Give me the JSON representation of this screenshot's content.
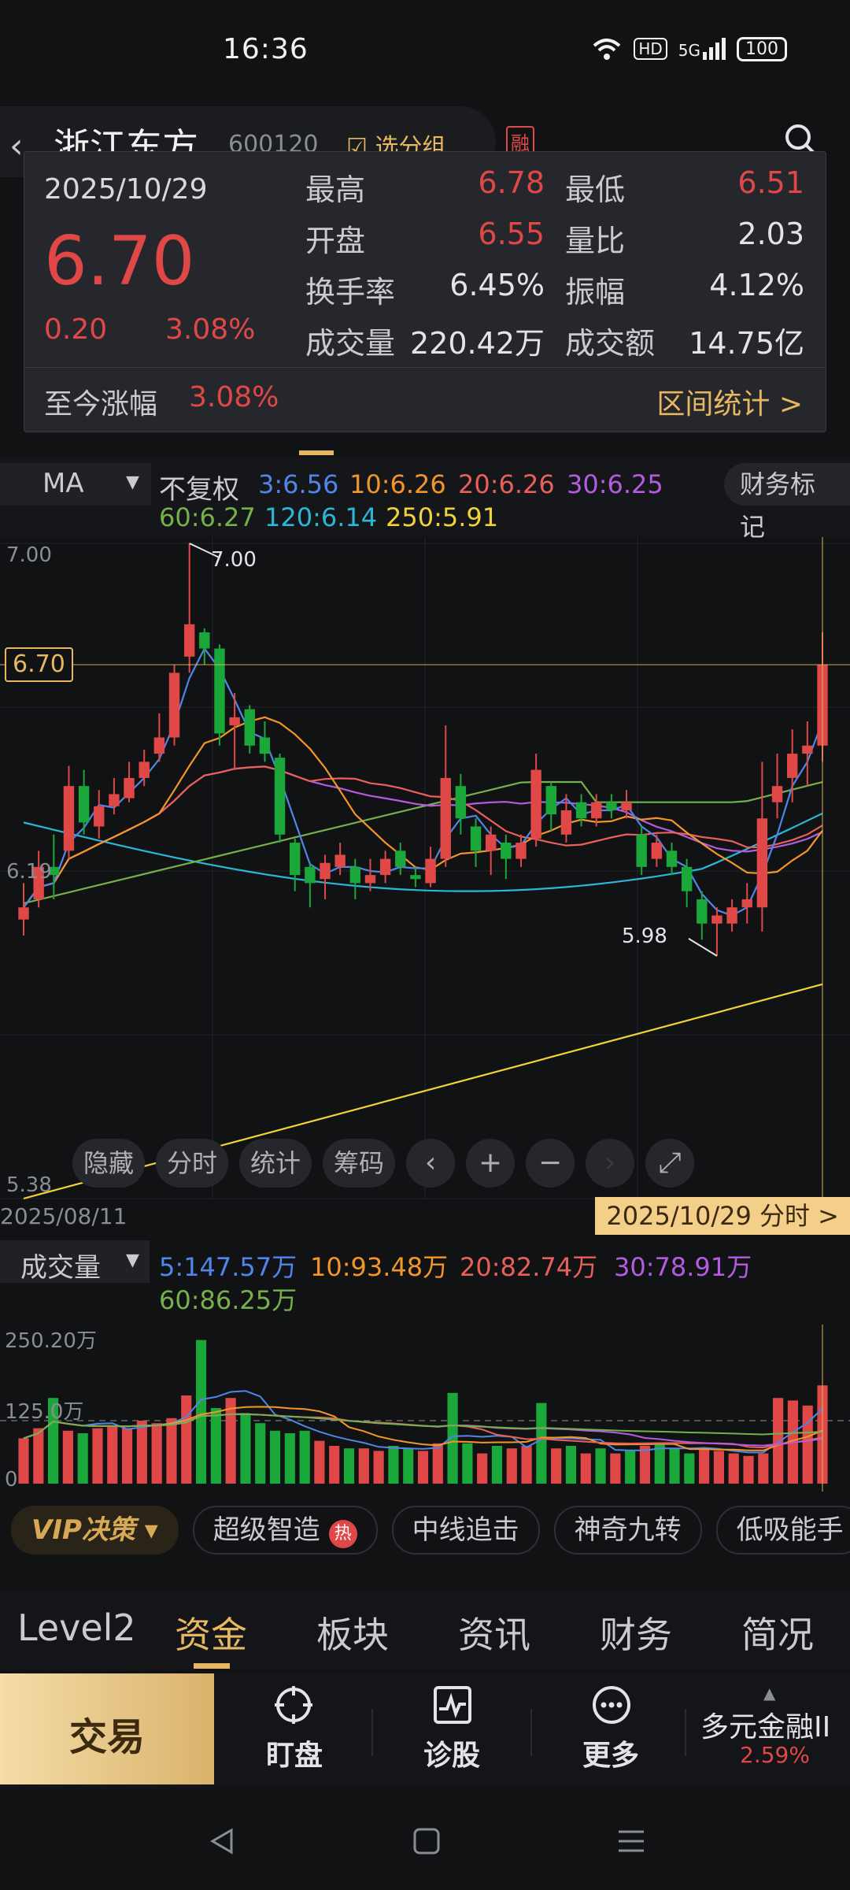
{
  "status_bar": {
    "time": "16:36",
    "hd": "HD",
    "signal": "5G",
    "battery": "100"
  },
  "header": {
    "stock_name": "浙江东方",
    "stock_code": "600120",
    "add_group": "选分组",
    "badge": "融"
  },
  "info_card": {
    "date": "2025/10/29",
    "price": "6.70",
    "change": "0.20",
    "change_pct": "3.08%",
    "rows": [
      {
        "l1": "最高",
        "v1": "6.78",
        "l2": "最低",
        "v2": "6.51"
      },
      {
        "l1": "开盘",
        "v1": "6.55",
        "l2": "量比",
        "v2": "2.03"
      },
      {
        "l1": "换手率",
        "v1": "6.45%",
        "l2": "振幅",
        "v2": "4.12%"
      },
      {
        "l1": "成交量",
        "v1": "220.42万",
        "l2": "成交额",
        "v2": "14.75亿"
      }
    ],
    "cum_label": "至今涨幅",
    "cum_value": "3.08%",
    "range_stats": "区间统计 >"
  },
  "ma_bar": {
    "selector": "MA",
    "adjust": "不复权",
    "ma3": "3:6.56",
    "ma10": "10:6.26",
    "ma20": "20:6.26",
    "ma30": "30:6.25",
    "ma60": "60:6.27",
    "ma120": "120:6.14",
    "ma250": "250:5.91",
    "fin_mark": "财务标记"
  },
  "colors": {
    "up": "#e04848",
    "down": "#1aa83a",
    "ma3": "#4f86e8",
    "ma10": "#f2962c",
    "ma20": "#e8605a",
    "ma30": "#b35ce0",
    "ma60": "#76b04a",
    "ma120": "#2bb7d6",
    "ma250": "#f2d23a",
    "accent": "#e7b861"
  },
  "chart_data": {
    "type": "candlestick",
    "y_axis_top": "7.00",
    "y_axis_mid": "6.19",
    "y_axis_bottom": "5.38",
    "ylim": [
      5.38,
      7.0
    ],
    "current_price_label": "6.70",
    "high_annotation": "7.00",
    "low_annotation": "5.98",
    "x_start": "2025/08/11",
    "x_end": "2025/10/29 分时 >",
    "candles": [
      {
        "o": 6.07,
        "c": 6.1,
        "h": 6.16,
        "l": 6.03
      },
      {
        "o": 6.12,
        "c": 6.2,
        "h": 6.24,
        "l": 6.1
      },
      {
        "o": 6.2,
        "c": 6.18,
        "h": 6.28,
        "l": 6.12
      },
      {
        "o": 6.24,
        "c": 6.4,
        "h": 6.45,
        "l": 6.22
      },
      {
        "o": 6.4,
        "c": 6.31,
        "h": 6.44,
        "l": 6.28
      },
      {
        "o": 6.3,
        "c": 6.35,
        "h": 6.39,
        "l": 6.27
      },
      {
        "o": 6.35,
        "c": 6.38,
        "h": 6.42,
        "l": 6.33
      },
      {
        "o": 6.37,
        "c": 6.42,
        "h": 6.46,
        "l": 6.36
      },
      {
        "o": 6.42,
        "c": 6.46,
        "h": 6.49,
        "l": 6.4
      },
      {
        "o": 6.48,
        "c": 6.52,
        "h": 6.58,
        "l": 6.46
      },
      {
        "o": 6.52,
        "c": 6.68,
        "h": 6.7,
        "l": 6.5
      },
      {
        "o": 6.72,
        "c": 6.8,
        "h": 7.0,
        "l": 6.68
      },
      {
        "o": 6.78,
        "c": 6.74,
        "h": 6.79,
        "l": 6.7
      },
      {
        "o": 6.74,
        "c": 6.53,
        "h": 6.75,
        "l": 6.5
      },
      {
        "o": 6.55,
        "c": 6.57,
        "h": 6.63,
        "l": 6.44
      },
      {
        "o": 6.59,
        "c": 6.5,
        "h": 6.6,
        "l": 6.48
      },
      {
        "o": 6.52,
        "c": 6.48,
        "h": 6.56,
        "l": 6.46
      },
      {
        "o": 6.47,
        "c": 6.28,
        "h": 6.48,
        "l": 6.26
      },
      {
        "o": 6.26,
        "c": 6.18,
        "h": 6.27,
        "l": 6.14
      },
      {
        "o": 6.2,
        "c": 6.16,
        "h": 6.21,
        "l": 6.1
      },
      {
        "o": 6.17,
        "c": 6.21,
        "h": 6.23,
        "l": 6.12
      },
      {
        "o": 6.2,
        "c": 6.23,
        "h": 6.26,
        "l": 6.18
      },
      {
        "o": 6.2,
        "c": 6.16,
        "h": 6.22,
        "l": 6.12
      },
      {
        "o": 6.16,
        "c": 6.18,
        "h": 6.22,
        "l": 6.14
      },
      {
        "o": 6.18,
        "c": 6.22,
        "h": 6.24,
        "l": 6.16
      },
      {
        "o": 6.24,
        "c": 6.2,
        "h": 6.26,
        "l": 6.18
      },
      {
        "o": 6.18,
        "c": 6.17,
        "h": 6.2,
        "l": 6.15
      },
      {
        "o": 6.16,
        "c": 6.22,
        "h": 6.25,
        "l": 6.15
      },
      {
        "o": 6.22,
        "c": 6.42,
        "h": 6.55,
        "l": 6.2
      },
      {
        "o": 6.4,
        "c": 6.32,
        "h": 6.43,
        "l": 6.28
      },
      {
        "o": 6.3,
        "c": 6.24,
        "h": 6.32,
        "l": 6.2
      },
      {
        "o": 6.24,
        "c": 6.28,
        "h": 6.3,
        "l": 6.18
      },
      {
        "o": 6.26,
        "c": 6.22,
        "h": 6.28,
        "l": 6.17
      },
      {
        "o": 6.22,
        "c": 6.26,
        "h": 6.28,
        "l": 6.2
      },
      {
        "o": 6.27,
        "c": 6.44,
        "h": 6.48,
        "l": 6.25
      },
      {
        "o": 6.4,
        "c": 6.33,
        "h": 6.41,
        "l": 6.29
      },
      {
        "o": 6.28,
        "c": 6.34,
        "h": 6.38,
        "l": 6.26
      },
      {
        "o": 6.36,
        "c": 6.32,
        "h": 6.38,
        "l": 6.3
      },
      {
        "o": 6.32,
        "c": 6.36,
        "h": 6.38,
        "l": 6.3
      },
      {
        "o": 6.36,
        "c": 6.34,
        "h": 6.38,
        "l": 6.32
      },
      {
        "o": 6.34,
        "c": 6.36,
        "h": 6.39,
        "l": 6.32
      },
      {
        "o": 6.28,
        "c": 6.2,
        "h": 6.3,
        "l": 6.18
      },
      {
        "o": 6.22,
        "c": 6.26,
        "h": 6.28,
        "l": 6.2
      },
      {
        "o": 6.24,
        "c": 6.2,
        "h": 6.26,
        "l": 6.18
      },
      {
        "o": 6.2,
        "c": 6.14,
        "h": 6.22,
        "l": 6.1
      },
      {
        "o": 6.12,
        "c": 6.06,
        "h": 6.14,
        "l": 6.02
      },
      {
        "o": 6.06,
        "c": 6.08,
        "h": 6.1,
        "l": 5.98
      },
      {
        "o": 6.06,
        "c": 6.1,
        "h": 6.12,
        "l": 6.04
      },
      {
        "o": 6.1,
        "c": 6.12,
        "h": 6.16,
        "l": 6.06
      },
      {
        "o": 6.1,
        "c": 6.32,
        "h": 6.46,
        "l": 6.04
      },
      {
        "o": 6.36,
        "c": 6.4,
        "h": 6.48,
        "l": 6.32
      },
      {
        "o": 6.42,
        "c": 6.48,
        "h": 6.54,
        "l": 6.36
      },
      {
        "o": 6.48,
        "c": 6.5,
        "h": 6.56,
        "l": 6.4
      },
      {
        "o": 6.5,
        "c": 6.7,
        "h": 6.78,
        "l": 6.46
      }
    ]
  },
  "toolbar": {
    "hide": "隐藏",
    "intraday": "分时",
    "stats": "统计",
    "chips": "筹码"
  },
  "volume": {
    "selector": "成交量",
    "ma5": "5:147.57万",
    "ma10": "10:93.48万",
    "ma20": "20:82.74万",
    "ma30": "30:78.91万",
    "ma60": "60:86.25万",
    "y_top": "250.20万",
    "y_mid": "125.0万",
    "y_zero": "0",
    "bars": [
      90,
      110,
      170,
      105,
      100,
      110,
      115,
      110,
      125,
      120,
      130,
      175,
      285,
      150,
      170,
      140,
      120,
      105,
      100,
      105,
      85,
      75,
      70,
      70,
      65,
      75,
      70,
      65,
      80,
      180,
      80,
      60,
      75,
      70,
      75,
      160,
      70,
      75,
      60,
      70,
      60,
      65,
      75,
      80,
      70,
      60,
      70,
      65,
      60,
      55,
      60,
      170,
      165,
      155,
      195
    ]
  },
  "strategies": {
    "vip": "VIP决策",
    "s1": "超级智造",
    "hot": "热",
    "s2": "中线追击",
    "s3": "神奇九转",
    "s4": "低吸能手"
  },
  "nav": {
    "t1": "Level2",
    "t2": "资金",
    "t3": "板块",
    "t4": "资讯",
    "t5": "财务",
    "t6": "简况"
  },
  "actions": {
    "trade": "交易",
    "watch": "盯盘",
    "diagnose": "诊股",
    "more": "更多",
    "dy_name": "多元金融II",
    "dy_pct": "2.59%"
  }
}
